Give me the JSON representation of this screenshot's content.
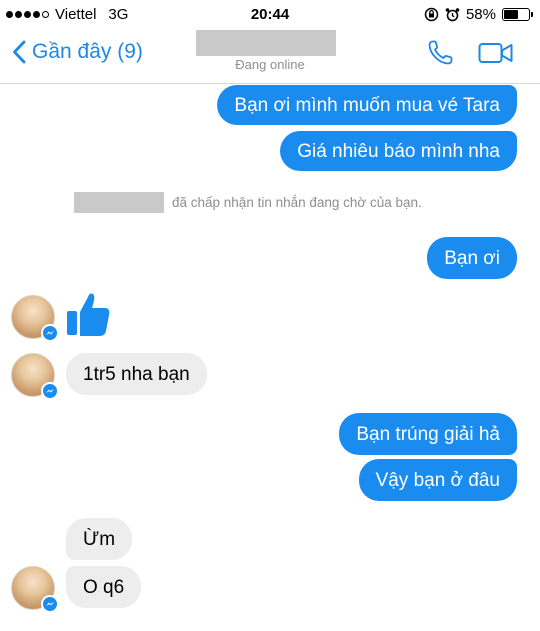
{
  "status_bar": {
    "carrier": "Viettel",
    "network": "3G",
    "time": "20:44",
    "battery": "58%",
    "battery_level": 0.58
  },
  "nav": {
    "back_label": "Gần đây (9)",
    "contact_status": "Đang online",
    "call_icon": "phone-icon",
    "video_icon": "video-camera-icon"
  },
  "colors": {
    "accent": "#1a8cf0",
    "incoming_bubble": "#ededed",
    "muted_text": "#8e8e93"
  },
  "notice": {
    "text": "đã chấp nhận tin nhắn đang chờ của bạn."
  },
  "messages": [
    {
      "side": "out",
      "text": "Bạn ơi mình muốn mua vé Tara"
    },
    {
      "side": "out",
      "text": "Giá nhiêu báo mình nha"
    },
    {
      "side": "out",
      "text": "Bạn ơi"
    },
    {
      "side": "in",
      "kind": "like-sticker",
      "icon": "thumbs-up-icon"
    },
    {
      "side": "in",
      "text": "1tr5 nha bạn"
    },
    {
      "side": "out",
      "text": "Bạn trúng giải hả"
    },
    {
      "side": "out",
      "text": "Vậy bạn ở đâu"
    },
    {
      "side": "in",
      "text": "Ừm"
    },
    {
      "side": "in",
      "text": "O q6"
    }
  ]
}
